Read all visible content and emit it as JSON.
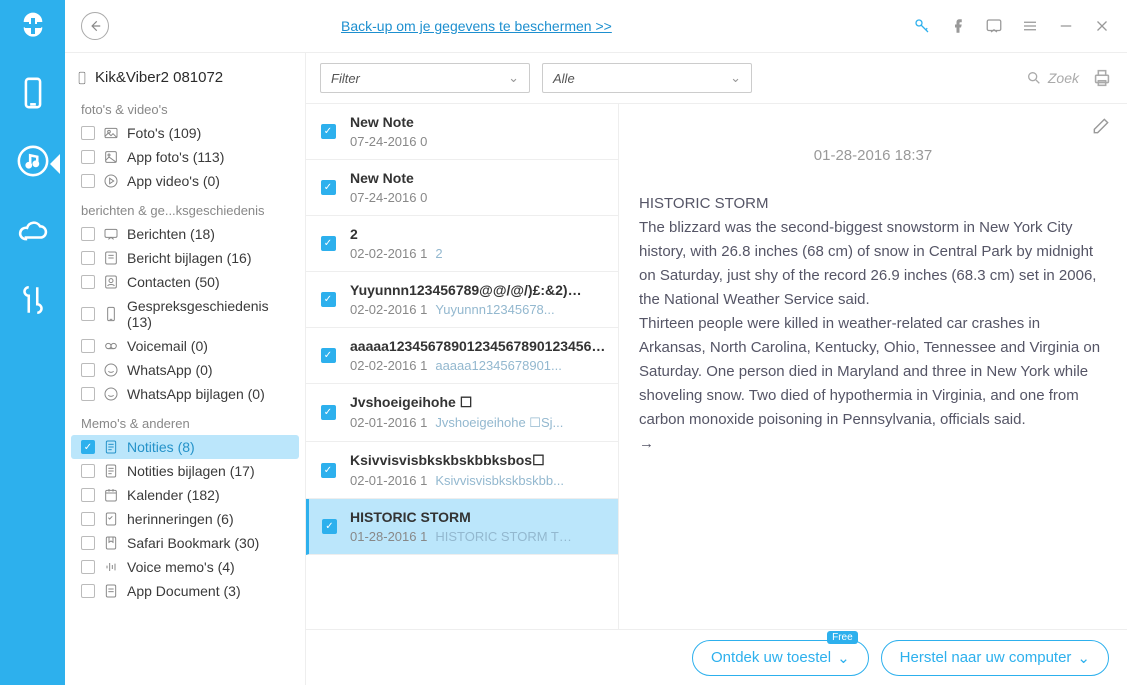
{
  "top": {
    "link": "Back-up om je gegevens te beschermen >>"
  },
  "tree": {
    "title": "Kik&Viber2 081072",
    "groups": [
      {
        "header": "foto's & video's",
        "items": [
          {
            "icon": "photo",
            "label": "Foto's (109)"
          },
          {
            "icon": "appphoto",
            "label": "App foto's (113)"
          },
          {
            "icon": "appvideo",
            "label": "App video's (0)"
          }
        ]
      },
      {
        "header": "berichten & ge...ksgeschiedenis",
        "items": [
          {
            "icon": "msg",
            "label": "Berichten (18)"
          },
          {
            "icon": "attach",
            "label": "Bericht bijlagen (16)"
          },
          {
            "icon": "contact",
            "label": "Contacten (50)"
          },
          {
            "icon": "call",
            "label": "Gespreksgeschiedenis (13)"
          },
          {
            "icon": "vm",
            "label": "Voicemail (0)"
          },
          {
            "icon": "wa",
            "label": "WhatsApp (0)"
          },
          {
            "icon": "wa",
            "label": "WhatsApp bijlagen (0)"
          }
        ]
      },
      {
        "header": "Memo's & anderen",
        "items": [
          {
            "icon": "note",
            "label": "Notities (8)",
            "selected": true
          },
          {
            "icon": "note",
            "label": "Notities bijlagen (17)"
          },
          {
            "icon": "cal",
            "label": "Kalender (182)"
          },
          {
            "icon": "rem",
            "label": "herinneringen (6)"
          },
          {
            "icon": "bm",
            "label": "Safari Bookmark (30)"
          },
          {
            "icon": "audio",
            "label": "Voice memo's (4)"
          },
          {
            "icon": "doc",
            "label": "App Document (3)"
          }
        ]
      }
    ]
  },
  "filters": {
    "filter": "Filter",
    "all": "Alle",
    "search": "Zoek"
  },
  "notes": [
    {
      "title": "New Note",
      "date": "07-24-2016 0",
      "prev": ""
    },
    {
      "title": "New Note",
      "date": "07-24-2016 0",
      "prev": ""
    },
    {
      "title": "2",
      "date": "02-02-2016 1",
      "prev": "2"
    },
    {
      "title": "Yuyunnn123456789@@/@/)£:&2)…",
      "date": "02-02-2016 1",
      "prev": "Yuyunnn12345678..."
    },
    {
      "title": "aaaaa12345678901234567890123456789012…",
      "date": "02-02-2016 1",
      "prev": "aaaaa12345678901..."
    },
    {
      "title": "Jvshoeigeihohe ☐",
      "date": "02-01-2016 1",
      "prev": "Jvshoeigeihohe ☐Sj..."
    },
    {
      "title": "Ksivvisvisbkskbskbbksbos☐",
      "date": "02-01-2016 1",
      "prev": "Ksivvisvisbkskbskbb..."
    },
    {
      "title": "HISTORIC STORM",
      "date": "01-28-2016 1",
      "prev": "HISTORIC STORM T…",
      "selected": true
    }
  ],
  "detail": {
    "time": "01-28-2016 18:37",
    "title": "HISTORIC STORM",
    "body": "The blizzard was the second-biggest snowstorm in New York City history, with 26.8 inches (68 cm) of snow in Central Park by midnight on Saturday, just shy of the record 26.9 inches (68.3 cm) set in 2006, the National Weather Service said.\nThirteen people were killed in weather-related car crashes in Arkansas, North Carolina, Kentucky, Ohio, Tennessee and Virginia on Saturday. One person died in Maryland and three in New York while shoveling snow. Two died of hypothermia in Virginia, and one from carbon monoxide poisoning in Pennsylvania, officials said.\n→"
  },
  "footer": {
    "discover": "Ontdek uw toestel",
    "badge": "Free",
    "recover": "Herstel naar uw computer"
  }
}
